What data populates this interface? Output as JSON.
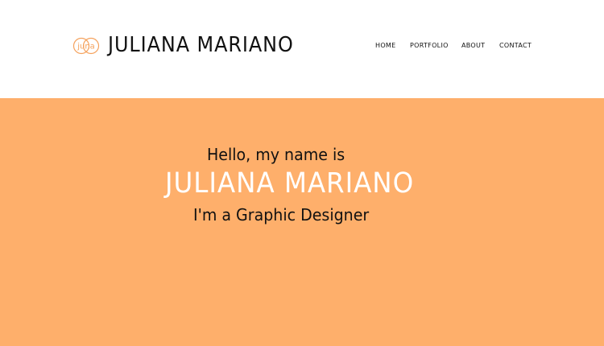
{
  "header": {
    "logo_text": "juna",
    "brand_name": "JULIANA MARIANO",
    "nav": [
      {
        "label": "HOME"
      },
      {
        "label": "PORTFOLIO"
      },
      {
        "label": "ABOUT"
      },
      {
        "label": "CONTACT"
      }
    ]
  },
  "hero": {
    "greeting": "Hello, my name is",
    "name": "JULIANA MARIANO",
    "role": "I'm a Graphic Designer"
  },
  "colors": {
    "accent": "#feaf6b",
    "logo": "#f5a25d",
    "text_dark": "#111111",
    "text_light": "#ffffff",
    "header_bg": "#ffffff"
  }
}
